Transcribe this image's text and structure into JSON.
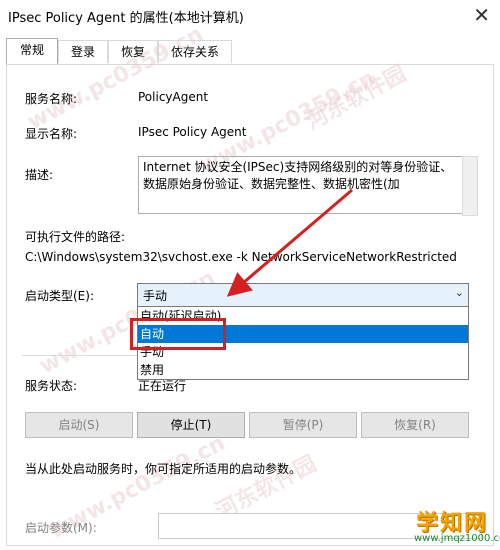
{
  "window": {
    "title": "IPsec Policy Agent 的属性(本地计算机)",
    "close_glyph": "✕"
  },
  "tabs": [
    "常规",
    "登录",
    "恢复",
    "依存关系"
  ],
  "general": {
    "service_name_label": "服务名称:",
    "service_name": "PolicyAgent",
    "display_name_label": "显示名称:",
    "display_name": "IPsec Policy Agent",
    "description_label": "描述:",
    "description": "Internet 协议安全(IPSec)支持网络级别的对等身份验证、数据原始身份验证、数据完整性、数据机密性(加",
    "exe_path_label": "可执行文件的路径:",
    "exe_path": "C:\\Windows\\system32\\svchost.exe -k NetworkServiceNetworkRestricted",
    "startup_type_label": "启动类型(E):",
    "startup_type_value": "手动",
    "startup_options": [
      "自动(延迟启动)",
      "自动",
      "手动",
      "禁用"
    ],
    "selected_option_index": 1,
    "service_status_label": "服务状态:",
    "service_status": "正在运行",
    "buttons": {
      "start": "启动(S)",
      "stop": "停止(T)",
      "pause": "暂停(P)",
      "resume": "恢复(R)"
    },
    "hint": "当从此处启动服务时，你可指定所适用的启动参数。",
    "start_params_label": "启动参数(M):"
  },
  "annotation": {
    "color": "#d61f1f"
  },
  "watermark": {
    "text1": "河东软件园",
    "text2": "www.pc0359.cn"
  },
  "logo": {
    "main": "学知网",
    "url": "www.jmqz1000.com"
  }
}
